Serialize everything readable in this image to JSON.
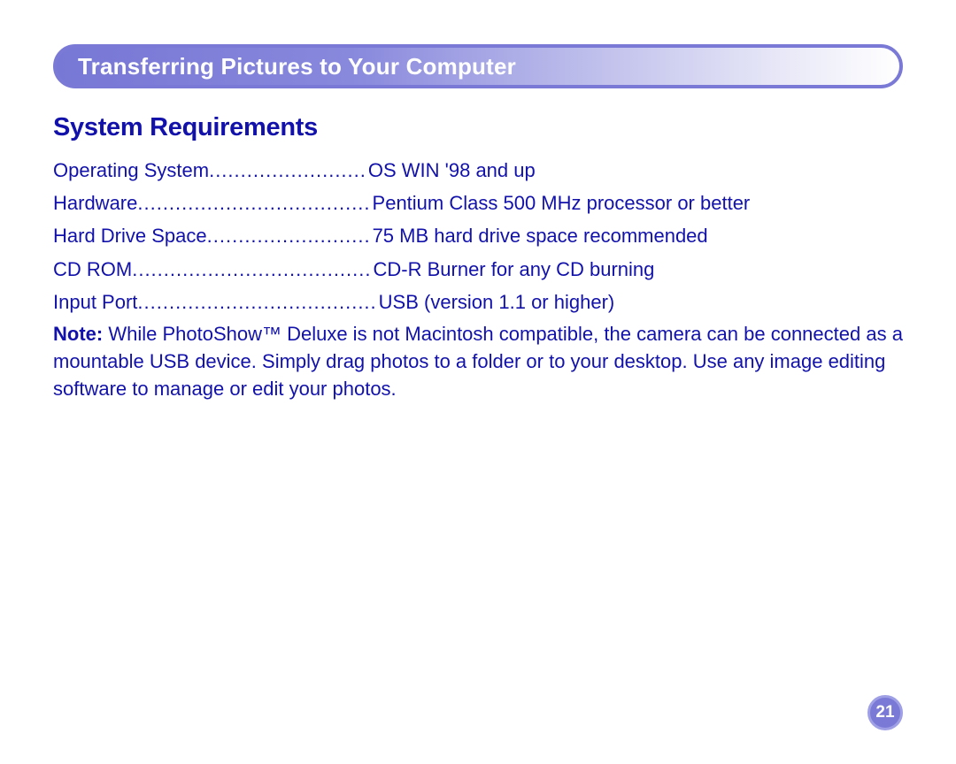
{
  "header": {
    "title": "Transferring Pictures to Your Computer"
  },
  "section": {
    "heading": "System Requirements"
  },
  "requirements": [
    {
      "label": "Operating System",
      "dots": ".........................",
      "value": "OS WIN '98 and up"
    },
    {
      "label": "Hardware",
      "dots": ".....................................",
      "value": "Pentium Class 500 MHz processor or better"
    },
    {
      "label": "Hard Drive Space",
      "dots": "..........................",
      "value": "75 MB hard drive space recommended"
    },
    {
      "label": "CD ROM ",
      "dots": "......................................",
      "value": "CD-R Burner for any CD burning"
    },
    {
      "label": "Input Port",
      "dots": "......................................",
      "value": "USB (version 1.1 or higher)"
    }
  ],
  "note": {
    "label": "Note:",
    "text": " While PhotoShow™ Deluxe is not Macintosh compatible, the camera can be connected as a mountable USB device. Simply drag photos to a folder or to your desktop. Use any image editing software to manage or edit your photos."
  },
  "page_number": "21"
}
